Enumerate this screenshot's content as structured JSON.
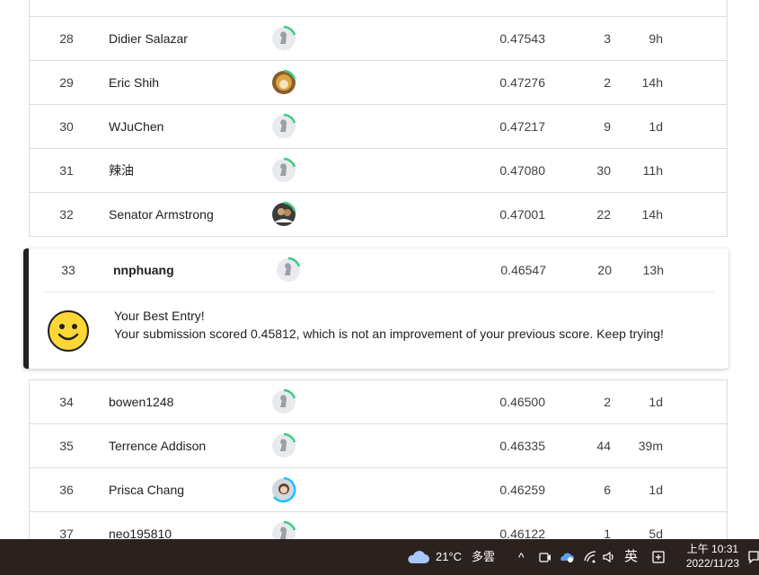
{
  "leaderboard": {
    "rows_before": [
      {
        "rank": "28",
        "name": "Didier Salazar",
        "score": "0.47543",
        "entries": "3",
        "last": "9h",
        "avatar": "default"
      },
      {
        "rank": "29",
        "name": "Eric Shih",
        "score": "0.47276",
        "entries": "2",
        "last": "14h",
        "avatar": "photo-orange"
      },
      {
        "rank": "30",
        "name": "WJuChen",
        "score": "0.47217",
        "entries": "9",
        "last": "1d",
        "avatar": "default"
      },
      {
        "rank": "31",
        "name": "辣油",
        "score": "0.47080",
        "entries": "30",
        "last": "11h",
        "avatar": "default"
      },
      {
        "rank": "32",
        "name": "Senator Armstrong",
        "score": "0.47001",
        "entries": "22",
        "last": "14h",
        "avatar": "photo-dark"
      }
    ],
    "current_user": {
      "rank": "33",
      "name": "nnphuang",
      "score": "0.46547",
      "entries": "20",
      "last": "13h",
      "message_title": "Your Best Entry!",
      "message_body": "Your submission scored 0.45812, which is not an improvement of your previous score. Keep trying!"
    },
    "rows_after": [
      {
        "rank": "34",
        "name": "bowen1248",
        "score": "0.46500",
        "entries": "2",
        "last": "1d",
        "avatar": "default"
      },
      {
        "rank": "35",
        "name": "Terrence Addison",
        "score": "0.46335",
        "entries": "44",
        "last": "39m",
        "avatar": "default"
      },
      {
        "rank": "36",
        "name": "Prisca Chang",
        "score": "0.46259",
        "entries": "6",
        "last": "1d",
        "avatar": "photo-girl"
      },
      {
        "rank": "37",
        "name": "neo195810",
        "score": "0.46122",
        "entries": "1",
        "last": "5d",
        "avatar": "default"
      }
    ]
  },
  "taskbar": {
    "weather_temp": "21°C",
    "weather_desc": "多雲",
    "ime": "英",
    "time": "上午 10:31",
    "date": "2022/11/23"
  },
  "colors": {
    "progress_green": "#20beff",
    "ring_green": "#3ccb7f",
    "taskbar_bg": "#2b2220",
    "highlight_bar": "#202124"
  }
}
